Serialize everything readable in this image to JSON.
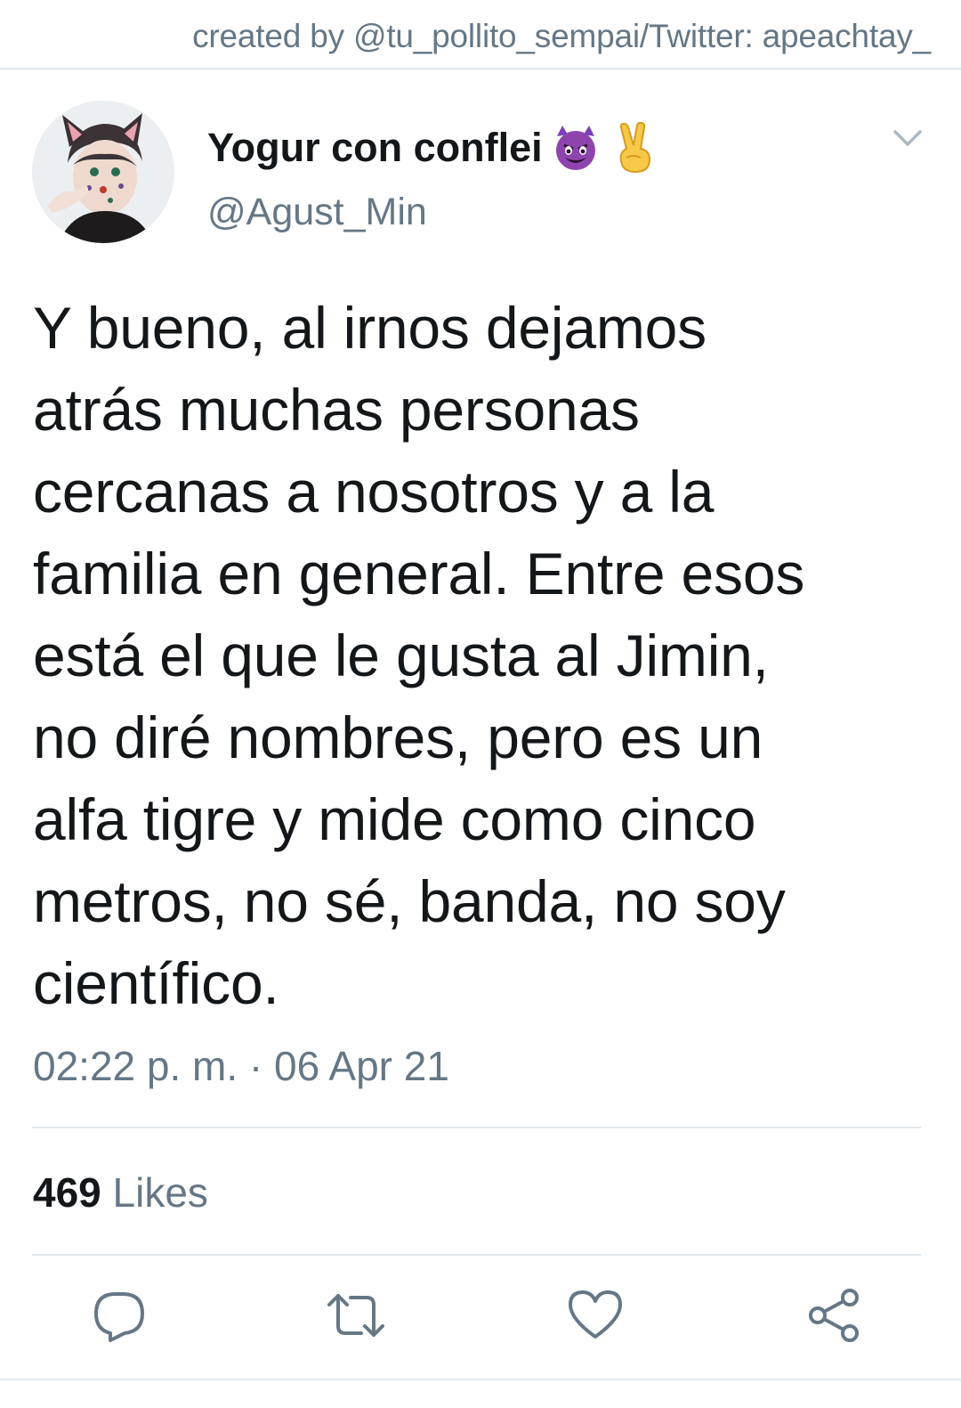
{
  "credit": {
    "text": "created by @tu_pollito_sempai/Twitter: apeachtay_"
  },
  "tweet": {
    "display_name": "Yogur con conflei",
    "name_emojis": [
      "smiling-imp-emoji",
      "victory-hand-emoji"
    ],
    "handle": "@Agust_Min",
    "text_lines": [
      "Y bueno, al irnos dejamos",
      "atrás muchas personas",
      "cercanas a nosotros y a la",
      "familia en general. Entre esos",
      "está el que le gusta al Jimin,",
      "no diré nombres, pero es un",
      "alfa tigre y mide como cinco",
      "metros, no sé, banda, no soy",
      "científico."
    ],
    "timestamp": "02:22 p. m. · 06 Apr 21",
    "likes_count": "469",
    "likes_label": "Likes"
  },
  "actions": [
    {
      "name": "reply",
      "icon": "reply-icon"
    },
    {
      "name": "retweet",
      "icon": "retweet-icon"
    },
    {
      "name": "like",
      "icon": "heart-icon"
    },
    {
      "name": "share",
      "icon": "share-icon"
    }
  ],
  "colors": {
    "text": "#14171a",
    "secondary": "#657786",
    "divider": "#e1e8ed",
    "emoji_purple": "#7b3fb8",
    "emoji_yellow": "#f7c948"
  }
}
